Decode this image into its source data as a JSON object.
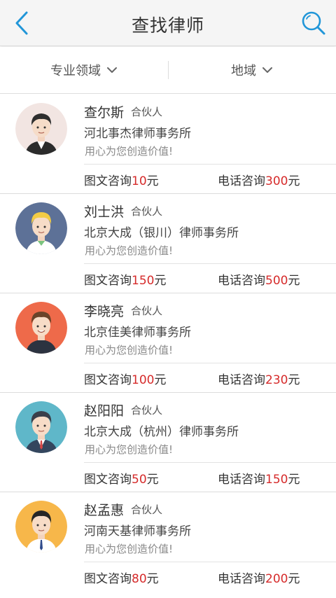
{
  "header": {
    "title": "查找律师",
    "back_icon": "chevron-left-icon",
    "search_icon": "search-icon",
    "accent": "#2196d8"
  },
  "filters": [
    {
      "label": "专业领域",
      "icon": "chevron-down-icon"
    },
    {
      "label": "地域",
      "icon": "chevron-down-icon"
    }
  ],
  "lawyers": [
    {
      "name": "查尔斯",
      "role": "合伙人",
      "firm": "河北事杰律师事务所",
      "slogan": "用心为您创造价值!",
      "text_label": "图文咨询",
      "text_price": "10",
      "text_unit": "元",
      "phone_label": "电话咨询",
      "phone_price": "300",
      "phone_unit": "元",
      "avatar_bg": "#f2e5e2"
    },
    {
      "name": "刘士洪",
      "role": "合伙人",
      "firm": "北京大成（银川）律师事务所",
      "slogan": "用心为您创造价值!",
      "text_label": "图文咨询",
      "text_price": "150",
      "text_unit": "元",
      "phone_label": "电话咨询",
      "phone_price": "500",
      "phone_unit": "元",
      "avatar_bg": "#5d7197"
    },
    {
      "name": "李晓亮",
      "role": "合伙人",
      "firm": "北京佳美律师事务所",
      "slogan": "用心为您创造价值!",
      "text_label": "图文咨询",
      "text_price": "100",
      "text_unit": "元",
      "phone_label": "电话咨询",
      "phone_price": "230",
      "phone_unit": "元",
      "avatar_bg": "#ee6a4a"
    },
    {
      "name": "赵阳阳",
      "role": "合伙人",
      "firm": "北京大成（杭州）律师事务所",
      "slogan": "用心为您创造价值!",
      "text_label": "图文咨询",
      "text_price": "50",
      "text_unit": "元",
      "phone_label": "电话咨询",
      "phone_price": "150",
      "phone_unit": "元",
      "avatar_bg": "#5fb7c9"
    },
    {
      "name": "赵孟惠",
      "role": "合伙人",
      "firm": "河南天基律师事务所",
      "slogan": "用心为您创造价值!",
      "text_label": "图文咨询",
      "text_price": "80",
      "text_unit": "元",
      "phone_label": "电话咨询",
      "phone_price": "200",
      "phone_unit": "元",
      "avatar_bg": "#f7b74a"
    }
  ],
  "price_color": "#d62b2b"
}
